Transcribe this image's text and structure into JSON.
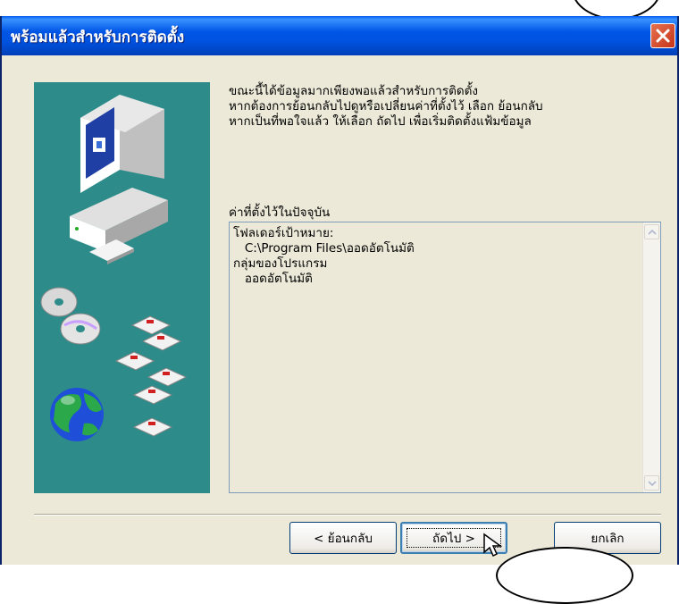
{
  "window": {
    "title": "พร้อมแล้วสำหรับการติดตั้ง"
  },
  "intro": {
    "lines": [
      "ขณะนี้ได้ข้อมูลมากเพียงพอแล้วสำหรับการติดตั้ง",
      "หากต้องการย้อนกลับไปดูหรือเปลี่ยนค่าที่ตั้งไว้ เลือก ย้อนกลับ",
      "หากเป็นที่พอใจแล้ว ให้เลือก ถัดไป เพื่อเริ่มติดตั้งแฟ้มข้อมูล"
    ]
  },
  "settings": {
    "label": "ค่าที่ตั้งไว้ในปัจจุบัน",
    "lines": [
      "โฟลเดอร์เป้าหมาย:",
      "   C:\\Program Files\\ออดอัตโนมัติ",
      "",
      "กลุ่มของโปรแกรม",
      "   ออดอัตโนมัติ"
    ]
  },
  "buttons": {
    "back": "< ย้อนกลับ",
    "next": "ถัดไป >",
    "cancel": "ยกเลิก"
  },
  "icons": {
    "close": "close-icon",
    "scroll_up": "chevron-up-icon",
    "scroll_down": "chevron-down-icon",
    "art": "computer-install-illustration"
  },
  "colors": {
    "titlebar": "#0054e3",
    "panel": "#2d8b89",
    "dialog_bg": "#ece9d8",
    "close_button": "#c8341a"
  }
}
